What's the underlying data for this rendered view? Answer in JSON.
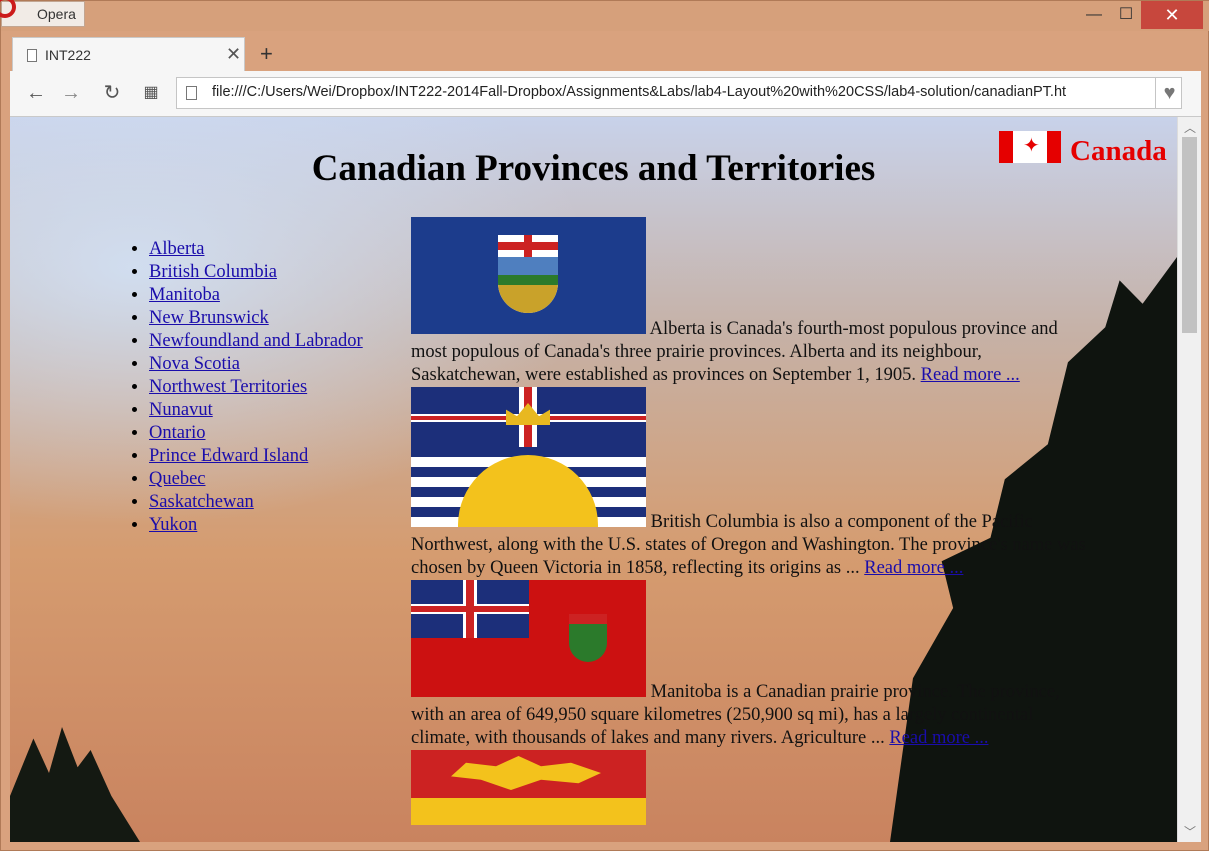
{
  "browser": {
    "app_name": "Opera",
    "tab_title": "INT222",
    "tab_close": "✕",
    "new_tab": "+",
    "url": "file:///C:/Users/Wei/Dropbox/INT222-2014Fall-Dropbox/Assignments&Labs/lab4-Layout%20with%20CSS/lab4-solution/canadianPT.ht",
    "window_controls": {
      "minimize": "—",
      "maximize": "☐",
      "close": "✕"
    },
    "toolbar": {
      "back": "←",
      "forward": "→",
      "reload": "↻",
      "speed_dial": "▦",
      "bookmark": "♥"
    }
  },
  "page": {
    "title": "Canadian Provinces and Territories",
    "badge_text": "Canada",
    "nav": [
      "Alberta",
      "British Columbia",
      "Manitoba",
      "New Brunswick",
      "Newfoundland and Labrador",
      "Nova Scotia",
      "Northwest Territories",
      "Nunavut",
      "Ontario",
      "Prince Edward Island",
      "Quebec",
      "Saskatchewan",
      "Yukon"
    ],
    "provinces": [
      {
        "text": "Alberta is Canada's fourth-most populous province and most populous of Canada's three prairie provinces. Alberta and its neighbour, Saskatchewan, were established as provinces on September 1, 1905. ",
        "link": "Read more ..."
      },
      {
        "text": "British Columbia is also a component of the Pacific Northwest, along with the U.S. states of Oregon and Washington. The province's name was chosen by Queen Victoria in 1858, reflecting its origins as ... ",
        "link": "Read more ..."
      },
      {
        "text": "Manitoba is a Canadian prairie province. The province, with an area of 649,950 square kilometres (250,900 sq mi), has a largely continental climate, with thousands of lakes and many rivers. Agriculture ... ",
        "link": "Read more ..."
      }
    ]
  },
  "colors": {
    "accent_red": "#e50000",
    "link_blue": "#1a0dab",
    "window_frame": "#d6a07b",
    "close_button": "#c7473d"
  },
  "icons": [
    "opera-logo-icon",
    "document-icon",
    "back-arrow-icon",
    "forward-arrow-icon",
    "reload-icon",
    "speed-dial-icon",
    "heart-icon",
    "maple-leaf-icon"
  ]
}
